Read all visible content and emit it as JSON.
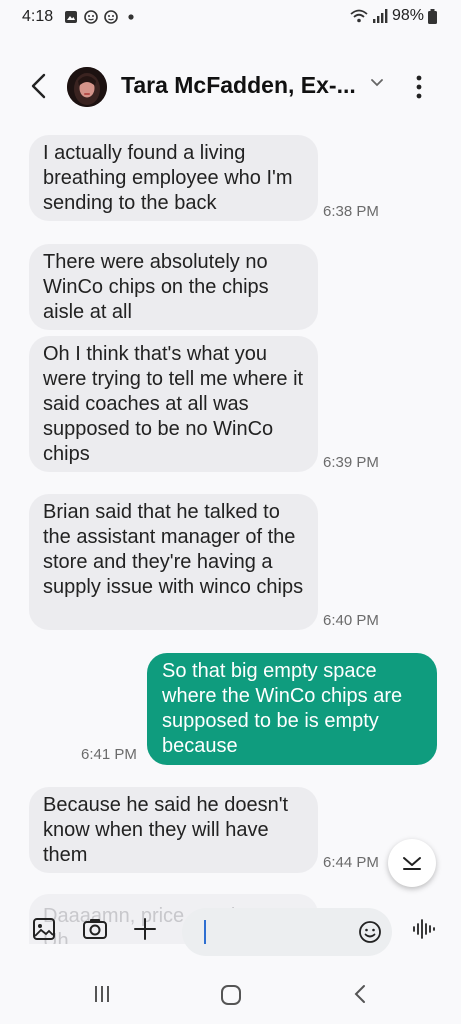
{
  "status": {
    "time": "4:18",
    "battery": "98%",
    "notification_icons": [
      "gallery-icon",
      "face-icon",
      "face-icon",
      "dot-icon"
    ]
  },
  "header": {
    "contact_name": "Tara McFadden, Ex-..."
  },
  "messages": [
    {
      "direction": "incoming",
      "text": "I actually found a living breathing employee who I'm sending to the back",
      "time": "6:38 PM"
    },
    {
      "direction": "incoming",
      "text": "There were absolutely no WinCo chips on the chips aisle at all",
      "time": ""
    },
    {
      "direction": "incoming",
      "text": "Oh I think that's what you were trying to tell me where it said coaches at all was supposed to be no WinCo chips",
      "time": "6:39 PM"
    },
    {
      "direction": "incoming",
      "text": "Brian said that he talked to the assistant manager of the store and they're having a supply issue with winco chips",
      "time": "6:40 PM"
    },
    {
      "direction": "outgoing",
      "text": "So that big empty space where the WinCo chips are supposed to be is empty because",
      "time": "6:41 PM"
    },
    {
      "direction": "incoming",
      "text": "Because he said he doesn't know when they will have them",
      "time": "6:44 PM"
    }
  ],
  "preview": {
    "text": "Daaaamn, price ... WinCo at Uh..."
  },
  "composer": {
    "input_value": ""
  }
}
